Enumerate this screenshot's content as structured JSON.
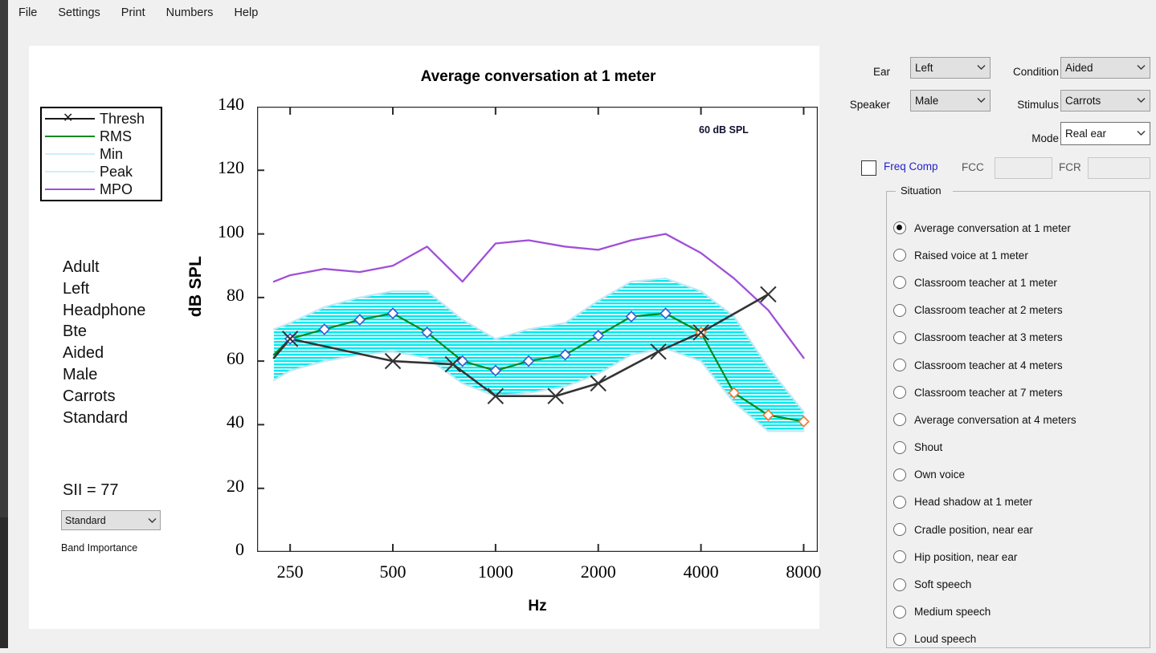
{
  "menu": {
    "items": [
      "File",
      "Settings",
      "Print",
      "Numbers",
      "Help"
    ]
  },
  "legend": {
    "entries": [
      {
        "label": "Thresh",
        "color": "#1a1a1a",
        "marker": "x"
      },
      {
        "label": "RMS",
        "color": "#0a8a1e",
        "marker": "none"
      },
      {
        "label": "Min",
        "color": "#cfeef5",
        "marker": "none"
      },
      {
        "label": "Peak",
        "color": "#cfeef5",
        "marker": "none"
      },
      {
        "label": "MPO",
        "color": "#a04fd8",
        "marker": "none"
      }
    ]
  },
  "info": {
    "lines": [
      "Adult",
      "Left",
      "Headphone",
      "Bte",
      "Aided",
      "Male",
      "Carrots",
      "Standard"
    ],
    "sii": "SII = 77",
    "band_importance_value": "Standard",
    "band_importance_label": "Band Importance"
  },
  "controls": {
    "ear_label": "Ear",
    "ear_value": "Left",
    "condition_label": "Condition",
    "condition_value": "Aided",
    "speaker_label": "Speaker",
    "speaker_value": "Male",
    "stimulus_label": "Stimulus",
    "stimulus_value": "Carrots",
    "mode_label": "Mode",
    "mode_value": "Real ear",
    "freq_comp_label": "Freq Comp",
    "fcc_label": "FCC",
    "fcc_value": "",
    "fcr_label": "FCR",
    "fcr_value": ""
  },
  "situation": {
    "title": "Situation",
    "selected_index": 0,
    "options": [
      "Average conversation at 1 meter",
      "Raised voice at 1 meter",
      "Classroom teacher at 1 meter",
      "Classroom teacher at 2 meters",
      "Classroom teacher at 3 meters",
      "Classroom teacher at 4 meters",
      "Classroom teacher at 7 meters",
      "Average conversation at 4 meters",
      "Shout",
      "Own voice",
      "Head shadow at 1 meter",
      "Cradle position, near ear",
      "Hip position, near ear",
      "Soft speech",
      "Medium speech",
      "Loud speech"
    ]
  },
  "chart_data": {
    "type": "line",
    "title": "Average conversation at 1 meter",
    "annotation": "60 dB SPL",
    "xlabel": "Hz",
    "ylabel": "dB SPL",
    "xscale": "log",
    "xlim": [
      200,
      8800
    ],
    "ylim": [
      0,
      140
    ],
    "xticks": [
      250,
      500,
      1000,
      2000,
      4000,
      8000
    ],
    "xticklabels": [
      "250",
      "500",
      "1000",
      "2000",
      "4000",
      "8000"
    ],
    "yticks": [
      0,
      20,
      40,
      60,
      80,
      100,
      120,
      140
    ],
    "yticklabels": [
      "0",
      "20",
      "40",
      "60",
      "80",
      "100",
      "120",
      "140"
    ],
    "yminorstep": 10,
    "grid": false,
    "legend_position": "outside-upper-left",
    "colors": {
      "thresh": "#333333",
      "rms": "#0a8a1e",
      "band_fill": "#00e8ef",
      "band_edge": "#bfe8f4",
      "mpo": "#a04fd8",
      "marker_audible": "#3b5fd0",
      "marker_inaudible": "#f07838"
    },
    "series": [
      {
        "name": "Thresh",
        "x": [
          224,
          250,
          500,
          750,
          1000,
          1500,
          2000,
          3000,
          4000,
          6300
        ],
        "values": [
          61,
          67,
          60,
          59,
          49,
          49,
          53,
          63,
          69,
          81
        ]
      },
      {
        "name": "RMS",
        "x": [
          224,
          250,
          315,
          400,
          500,
          630,
          800,
          1000,
          1250,
          1600,
          2000,
          2500,
          3150,
          4000,
          5000,
          6300,
          8000
        ],
        "values": [
          62,
          67,
          70,
          73,
          75,
          69,
          60,
          57,
          60,
          62,
          68,
          74,
          75,
          69,
          50,
          43,
          41
        ]
      },
      {
        "name": "Peak",
        "x": [
          224,
          250,
          315,
          400,
          500,
          630,
          800,
          1000,
          1250,
          1600,
          2000,
          2500,
          3150,
          4000,
          5000,
          6300,
          8000
        ],
        "values": [
          70,
          72,
          77,
          80,
          82,
          82,
          73,
          67,
          70,
          72,
          79,
          85,
          86,
          82,
          74,
          58,
          44
        ]
      },
      {
        "name": "Min",
        "x": [
          224,
          250,
          315,
          400,
          500,
          630,
          800,
          1000,
          1250,
          1600,
          2000,
          2500,
          3150,
          4000,
          5000,
          6300,
          8000
        ],
        "values": [
          54,
          57,
          60,
          62,
          63,
          61,
          53,
          49,
          50,
          52,
          56,
          62,
          64,
          60,
          47,
          38,
          38
        ]
      },
      {
        "name": "MPO",
        "x": [
          224,
          250,
          315,
          400,
          500,
          630,
          800,
          1000,
          1250,
          1600,
          2000,
          2500,
          3150,
          4000,
          5000,
          6300,
          8000
        ],
        "values": [
          85,
          87,
          89,
          88,
          90,
          96,
          85,
          97,
          98,
          96,
          95,
          98,
          100,
          94,
          86,
          76,
          61
        ]
      }
    ],
    "rms_markers": {
      "x": [
        250,
        315,
        400,
        500,
        630,
        800,
        1000,
        1250,
        1600,
        2000,
        2500,
        3150,
        4000,
        5000,
        6300,
        8000
      ],
      "values": [
        67,
        70,
        73,
        75,
        69,
        60,
        57,
        60,
        62,
        68,
        74,
        75,
        69,
        50,
        43,
        41
      ],
      "audible": [
        true,
        true,
        true,
        true,
        true,
        true,
        true,
        true,
        true,
        true,
        true,
        true,
        false,
        false,
        false,
        false
      ]
    }
  }
}
